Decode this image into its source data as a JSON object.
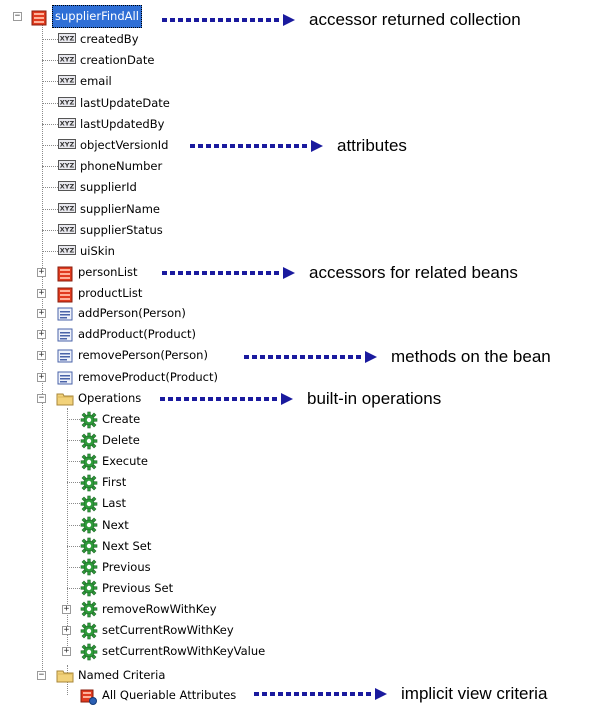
{
  "tree": {
    "root": {
      "label": "supplierFindAll",
      "icon": "collection-icon",
      "selected": true
    },
    "attributes": [
      {
        "label": "createdBy",
        "icon": "attribute-icon"
      },
      {
        "label": "creationDate",
        "icon": "attribute-icon"
      },
      {
        "label": "email",
        "icon": "attribute-icon"
      },
      {
        "label": "lastUpdateDate",
        "icon": "attribute-icon"
      },
      {
        "label": "lastUpdatedBy",
        "icon": "attribute-icon"
      },
      {
        "label": "objectVersionId",
        "icon": "attribute-icon"
      },
      {
        "label": "phoneNumber",
        "icon": "attribute-icon"
      },
      {
        "label": "supplierId",
        "icon": "attribute-icon"
      },
      {
        "label": "supplierName",
        "icon": "attribute-icon"
      },
      {
        "label": "supplierStatus",
        "icon": "attribute-icon"
      },
      {
        "label": "uiSkin",
        "icon": "attribute-icon"
      }
    ],
    "accessors": [
      {
        "label": "personList",
        "icon": "collection-icon"
      },
      {
        "label": "productList",
        "icon": "collection-icon"
      }
    ],
    "methods": [
      {
        "label": "addPerson(Person)",
        "icon": "method-icon"
      },
      {
        "label": "addProduct(Product)",
        "icon": "method-icon"
      },
      {
        "label": "removePerson(Person)",
        "icon": "method-icon"
      },
      {
        "label": "removeProduct(Product)",
        "icon": "method-icon"
      }
    ],
    "operations_folder": {
      "label": "Operations",
      "icon": "folder-icon"
    },
    "operations": [
      {
        "label": "Create",
        "icon": "gear-icon"
      },
      {
        "label": "Delete",
        "icon": "gear-icon"
      },
      {
        "label": "Execute",
        "icon": "gear-icon"
      },
      {
        "label": "First",
        "icon": "gear-icon"
      },
      {
        "label": "Last",
        "icon": "gear-icon"
      },
      {
        "label": "Next",
        "icon": "gear-icon"
      },
      {
        "label": "Next Set",
        "icon": "gear-icon"
      },
      {
        "label": "Previous",
        "icon": "gear-icon"
      },
      {
        "label": "Previous Set",
        "icon": "gear-icon"
      },
      {
        "label": "removeRowWithKey",
        "icon": "gear-icon"
      },
      {
        "label": "setCurrentRowWithKey",
        "icon": "gear-icon"
      },
      {
        "label": "setCurrentRowWithKeyValue",
        "icon": "gear-icon"
      }
    ],
    "criteria_folder": {
      "label": "Named Criteria",
      "icon": "folder-icon"
    },
    "criteria": [
      {
        "label": "All Queriable Attributes",
        "icon": "view-criteria-icon"
      }
    ]
  },
  "callouts": {
    "collection": "accessor returned collection",
    "attributes": "attributes",
    "accessors": "accessors for related beans",
    "methods": "methods on the bean",
    "operations": "built-in operations",
    "criteria": "implicit view criteria"
  },
  "colors": {
    "arrow": "#1a1a9e",
    "selection": "#2f6fd6",
    "gear": "#2e9b3a",
    "collection": "#e03b1f",
    "folder": "#f2d27a"
  }
}
